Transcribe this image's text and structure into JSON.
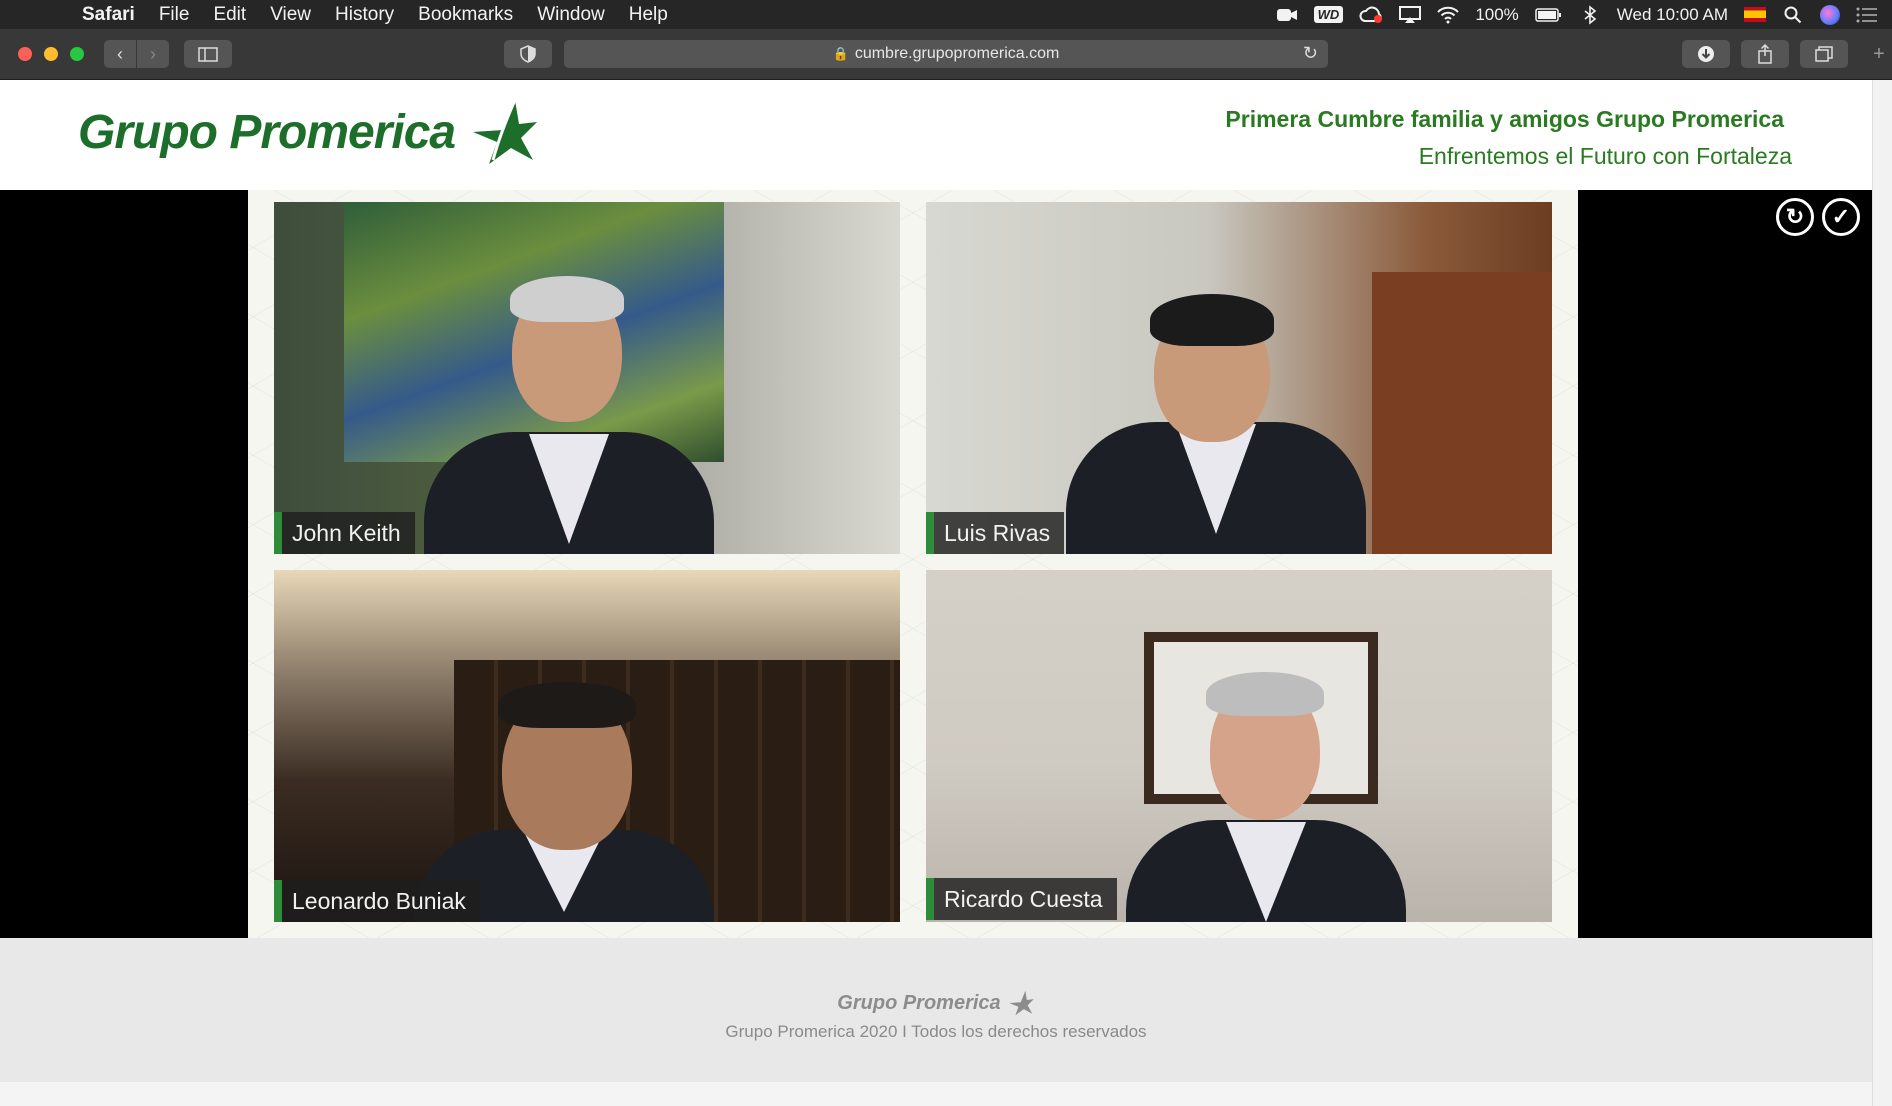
{
  "menubar": {
    "app": "Safari",
    "items": [
      "File",
      "Edit",
      "View",
      "History",
      "Bookmarks",
      "Window",
      "Help"
    ],
    "battery": "100%",
    "wd_badge": "WD",
    "clock": "Wed 10:00 AM",
    "icons": [
      "apple-icon",
      "camera-icon",
      "wd-icon",
      "creative-cloud-icon",
      "airplay-icon",
      "wifi-icon",
      "battery-icon",
      "bluetooth-icon",
      "flag-es-icon",
      "search-icon",
      "siri-icon",
      "notification-center-icon"
    ]
  },
  "toolbar": {
    "url": "cumbre.grupopromerica.com"
  },
  "header": {
    "logo_text": "Grupo Promerica",
    "title": "Primera Cumbre familia y amigos Grupo Promerica",
    "subtitle": "Enfrentemos el Futuro con Fortaleza"
  },
  "participants": [
    {
      "name": "John Keith"
    },
    {
      "name": "Luis Rivas"
    },
    {
      "name": "Leonardo Buniak"
    },
    {
      "name": "Ricardo Cuesta"
    }
  ],
  "controls": {
    "icons": [
      "refresh-icon",
      "check-icon"
    ]
  },
  "footer": {
    "logo_text": "Grupo Promerica",
    "copyright": "Grupo Promerica 2020 I Todos los derechos reservados"
  },
  "colors": {
    "brand_green": "#1d6e2a",
    "name_tag_accent": "#2e8b3a"
  }
}
